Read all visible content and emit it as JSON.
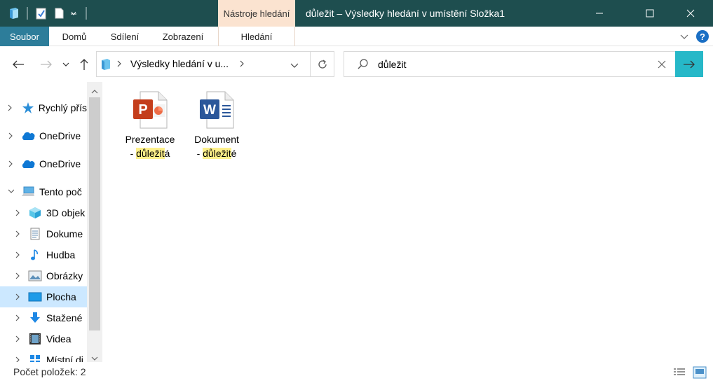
{
  "window": {
    "title": "důležit – Výsledky hledání v umístění Složka1",
    "context_tab": "Nástroje hledání"
  },
  "ribbon": {
    "tabs": [
      "Soubor",
      "Domů",
      "Sdílení",
      "Zobrazení",
      "Hledání"
    ]
  },
  "address": {
    "path": "Výsledky hledání v u..."
  },
  "search": {
    "value": "důležit"
  },
  "nav": {
    "items": [
      {
        "label": "Rychlý přís",
        "icon": "star-icon",
        "level": 0,
        "expanded": false
      },
      {
        "label": "OneDrive",
        "icon": "onedrive-icon",
        "level": 0,
        "expanded": false
      },
      {
        "label": "OneDrive",
        "icon": "onedrive-icon",
        "level": 0,
        "expanded": false
      },
      {
        "label": "Tento poč",
        "icon": "computer-icon",
        "level": 0,
        "expanded": true
      },
      {
        "label": "3D objek",
        "icon": "3d-objects-icon",
        "level": 1,
        "expanded": false
      },
      {
        "label": "Dokume",
        "icon": "documents-icon",
        "level": 1,
        "expanded": false
      },
      {
        "label": "Hudba",
        "icon": "music-icon",
        "level": 1,
        "expanded": false
      },
      {
        "label": "Obrázky",
        "icon": "pictures-icon",
        "level": 1,
        "expanded": false
      },
      {
        "label": "Plocha",
        "icon": "desktop-icon",
        "level": 1,
        "expanded": false,
        "selected": true
      },
      {
        "label": "Stažené",
        "icon": "downloads-icon",
        "level": 1,
        "expanded": false
      },
      {
        "label": "Videa",
        "icon": "videos-icon",
        "level": 1,
        "expanded": false
      },
      {
        "label": "Místní di",
        "icon": "local-disk-icon",
        "level": 1,
        "expanded": false
      }
    ]
  },
  "files": [
    {
      "line1": "Prezentace",
      "prefix": "- ",
      "match": "důležit",
      "suffix": "á",
      "icon": "powerpoint-icon"
    },
    {
      "line1": "Dokument",
      "prefix": "- ",
      "match": "důležit",
      "suffix": "é",
      "icon": "word-icon"
    }
  ],
  "status": {
    "text": "Počet položek: 2"
  }
}
